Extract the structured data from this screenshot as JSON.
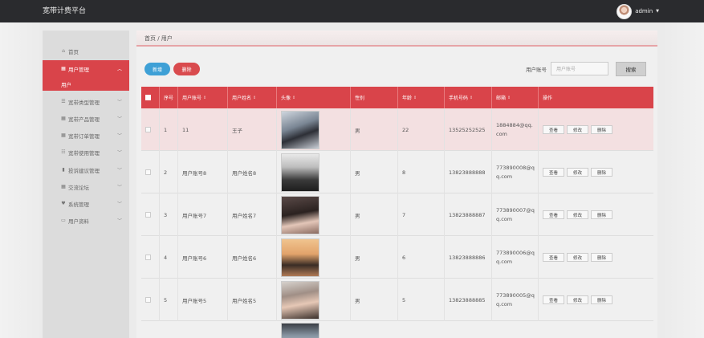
{
  "app": {
    "title": "宽带计费平台",
    "user": "admin"
  },
  "sidebar": {
    "home": "首页",
    "items": [
      {
        "label": "用户管理",
        "icon": "grid-icon"
      },
      {
        "label": "宽带类型管理",
        "icon": "list-icon"
      },
      {
        "label": "宽带产品管理",
        "icon": "grid-icon"
      },
      {
        "label": "宽带订单管理",
        "icon": "grid-icon"
      },
      {
        "label": "宽带使用管理",
        "icon": "sliders-icon"
      },
      {
        "label": "投诉建议管理",
        "icon": "bar-chart-icon"
      },
      {
        "label": "交流论坛",
        "icon": "grid-icon"
      },
      {
        "label": "系统管理",
        "icon": "heart-icon"
      },
      {
        "label": "用户资料",
        "icon": "card-icon"
      }
    ],
    "sub_item": "用户"
  },
  "breadcrumb": "首页 / 用户",
  "toolbar": {
    "add": "新增",
    "delete": "删除"
  },
  "search": {
    "label": "用户账号",
    "placeholder": "用户账号",
    "button": "搜索"
  },
  "table": {
    "columns": [
      "序号",
      "用户账号",
      "用户姓名",
      "头像",
      "性别",
      "年龄",
      "手机号码",
      "邮箱",
      "操作"
    ],
    "actions": [
      "查看",
      "修改",
      "删除"
    ],
    "rows": [
      {
        "index": "1",
        "account": "11",
        "name": "王子",
        "gender": "男",
        "age": "22",
        "phone": "13525252525",
        "email": "1884884@qq.com"
      },
      {
        "index": "2",
        "account": "用户账号8",
        "name": "用户姓名8",
        "gender": "男",
        "age": "8",
        "phone": "13823888888",
        "email": "773890008@qq.com"
      },
      {
        "index": "3",
        "account": "用户账号7",
        "name": "用户姓名7",
        "gender": "男",
        "age": "7",
        "phone": "13823888887",
        "email": "773890007@qq.com"
      },
      {
        "index": "4",
        "account": "用户账号6",
        "name": "用户姓名6",
        "gender": "男",
        "age": "6",
        "phone": "13823888886",
        "email": "773890006@qq.com"
      },
      {
        "index": "5",
        "account": "用户账号5",
        "name": "用户姓名5",
        "gender": "男",
        "age": "5",
        "phone": "13823888885",
        "email": "773890005@qq.com"
      }
    ]
  },
  "colors": {
    "accent": "#d9444a",
    "topbar": "#2a2b2e",
    "add_button": "#3ea0d6"
  }
}
